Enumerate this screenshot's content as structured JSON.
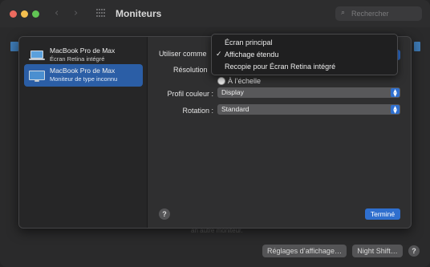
{
  "window": {
    "title": "Moniteurs",
    "search_placeholder": "Rechercher",
    "nav_back": "‹",
    "nav_forward": "›"
  },
  "sheet": {
    "displays": [
      {
        "name": "MacBook Pro de Max",
        "subtitle": "Écran Retina intégré",
        "selected": false
      },
      {
        "name": "MacBook Pro de Max",
        "subtitle": "Moniteur de type inconnu",
        "selected": true
      }
    ],
    "use_as_label": "Utiliser comme",
    "resolution_label": "Résolution",
    "resolution_option": "À l’échelle",
    "color_profile_label": "Profil couleur :",
    "color_profile_value": "Display",
    "rotation_label": "Rotation :",
    "rotation_value": "Standard",
    "help_label": "?",
    "done_label": "Terminé"
  },
  "menu": {
    "items": [
      {
        "label": "Écran principal",
        "checked": false
      },
      {
        "label": "Affichage étendu",
        "checked": true
      },
      {
        "label": "Recopie pour Écran Retina intégré",
        "checked": false
      }
    ],
    "check_glyph": "✓"
  },
  "background": {
    "caption": "an autre moniteur.",
    "display_settings_button": "Réglages d’affichage…",
    "night_shift_button": "Night Shift…",
    "help_label": "?"
  },
  "colors": {
    "accent": "#2f6fce",
    "selection": "#2b5ea6",
    "close": "#ec6a5e",
    "minimize": "#f4bf4f",
    "zoom": "#61c554"
  }
}
